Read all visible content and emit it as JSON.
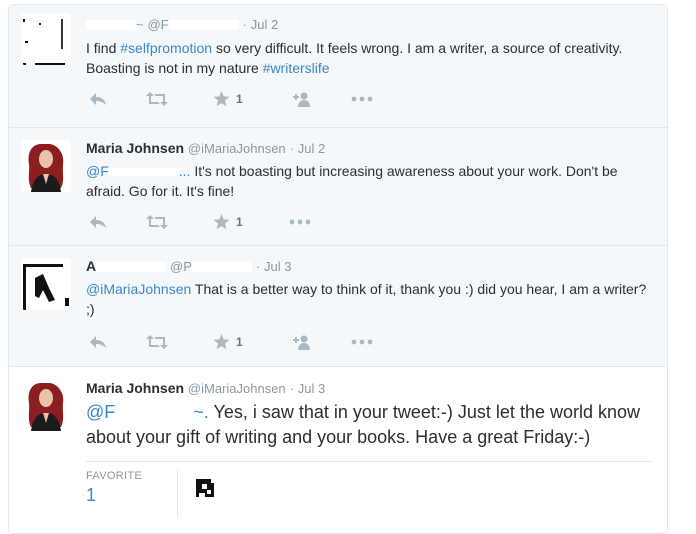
{
  "tweets": [
    {
      "name_suffix": "~",
      "handle_prefix": "@F",
      "time": "Jul 2",
      "text_pre": "I find ",
      "hashtag1": "#selfpromotion",
      "text_mid": " so very difficult. It feels wrong. I am a writer, a source of creativity. Boasting is not in my nature ",
      "hashtag2": "#writerslife",
      "favorites": "1"
    },
    {
      "fullname": "Maria Johnsen",
      "username": "@iMariaJohnsen",
      "time": "Jul 2",
      "mention_partial": "@F",
      "mention_tail": "...",
      "text_rest": "It's not boasting but increasing awareness about your work. Don't be afraid. Go for it. It's fine!",
      "favorites": "1"
    },
    {
      "name_initial": "A",
      "handle_prefix": "@P",
      "time": "Jul 3",
      "mention": "@iMariaJohnsen",
      "text_rest": " That is a better way to think of it, thank you :) did you hear, I am a writer? ;)",
      "favorites": "1"
    }
  ],
  "main": {
    "fullname": "Maria Johnsen",
    "username": "@iMariaJohnsen",
    "time": "Jul 3",
    "mention_partial": "@F",
    "mention_tail": "~.",
    "text_rest": " Yes, i saw that in your tweet:-) Just let the world know about your gift of writing and your books. Have a great Friday:-)",
    "stat_label": "FAVORITE",
    "stat_value": "1"
  },
  "ui": {
    "separator": "·",
    "accent_color": "#3b88c3",
    "action_icons": [
      "reply-icon",
      "retweet-icon",
      "favorite-icon",
      "follow-icon",
      "more-icon"
    ]
  }
}
